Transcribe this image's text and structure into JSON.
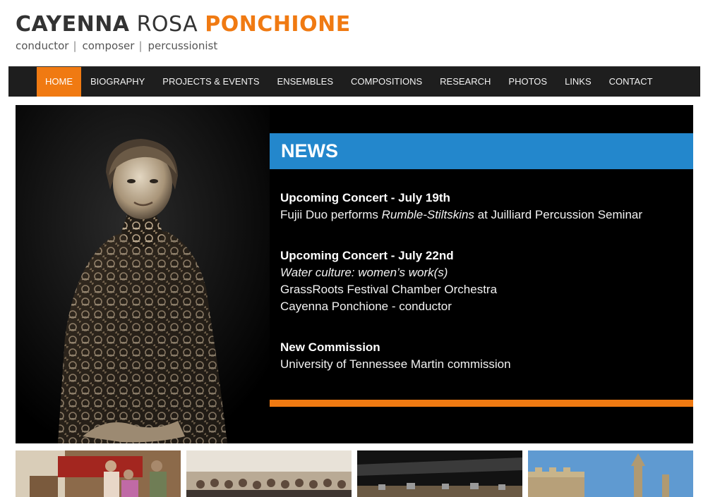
{
  "site": {
    "title_first": "CAYENNA",
    "title_middle": "ROSA",
    "title_last": "PONCHIONE",
    "tagline": [
      "conductor",
      "composer",
      "percussionist"
    ],
    "accent_color": "#f07a12",
    "news_color": "#2387cc"
  },
  "nav": {
    "items": [
      "HOME",
      "BIOGRAPHY",
      "PROJECTS & EVENTS",
      "ENSEMBLES",
      "COMPOSITIONS",
      "RESEARCH",
      "PHOTOS",
      "LINKS",
      "CONTACT"
    ],
    "active": "HOME"
  },
  "news": {
    "heading": "NEWS",
    "items": [
      {
        "headline": "Upcoming Concert - July 19th",
        "line1_pre": "Fujii Duo performs ",
        "line1_italic": "Rumble-Stiltskins",
        "line1_post": " at Juilliard Percussion Seminar"
      },
      {
        "headline": "Upcoming Concert - July 22nd",
        "line1_italic": "Water culture: women’s work(s)",
        "line2": "GrassRoots Festival Chamber Orchestra",
        "line3": "Cayenna Ponchione - conductor"
      },
      {
        "headline": "New Commission",
        "line1": "University of Tennessee Martin commission"
      }
    ]
  }
}
